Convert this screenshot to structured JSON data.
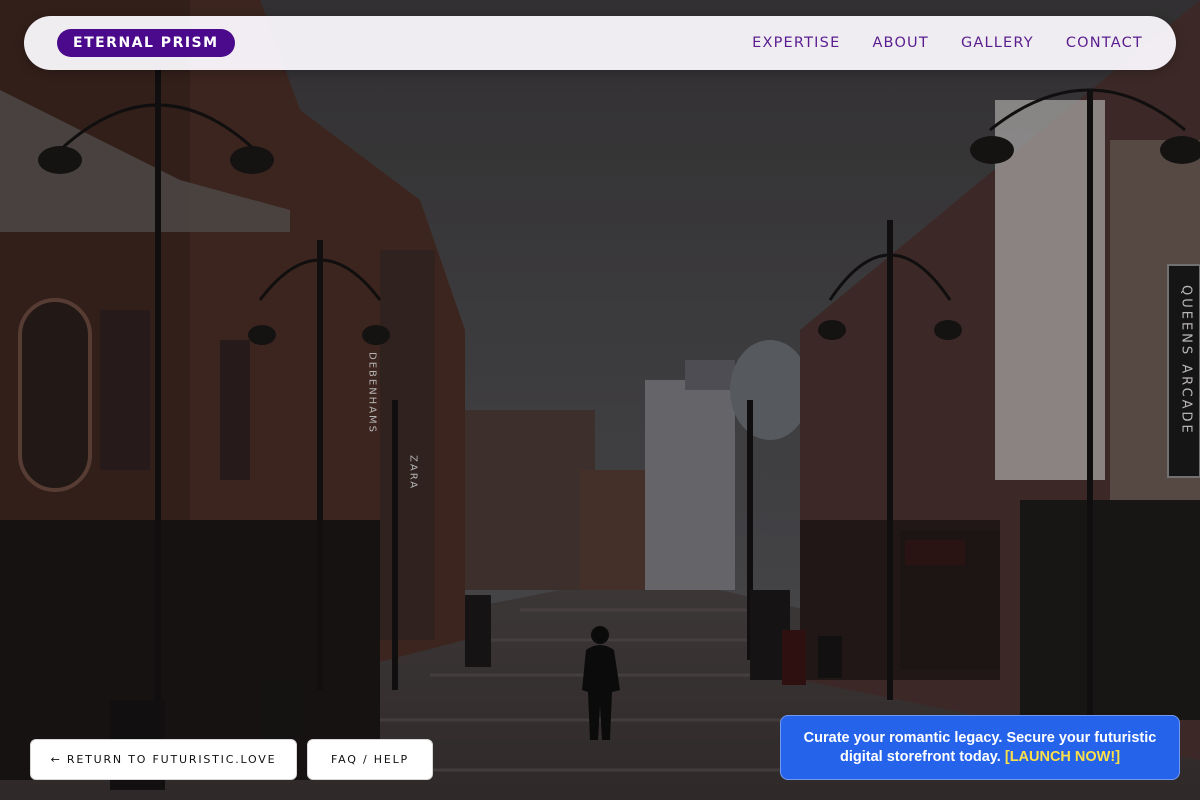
{
  "brand": {
    "name": "ETERNAL PRISM"
  },
  "nav": {
    "items": [
      "EXPERTISE",
      "ABOUT",
      "GALLERY",
      "CONTACT"
    ]
  },
  "buttons": {
    "return_label": "← RETURN TO FUTURISTIC.LOVE",
    "faq_label": "FAQ / HELP"
  },
  "promo": {
    "text": "Curate your romantic legacy. Secure your futuristic digital storefront today.",
    "cta": "[LAUNCH NOW!]"
  },
  "background": {
    "signs": [
      "QUEENS ARCADE",
      "DEBENHAMS",
      "ZARA"
    ]
  },
  "colors": {
    "brand_pill": "#4b0a8c",
    "nav_text": "#5a1d8f",
    "promo_bg": "#2563eb",
    "promo_cta": "#fde047"
  }
}
